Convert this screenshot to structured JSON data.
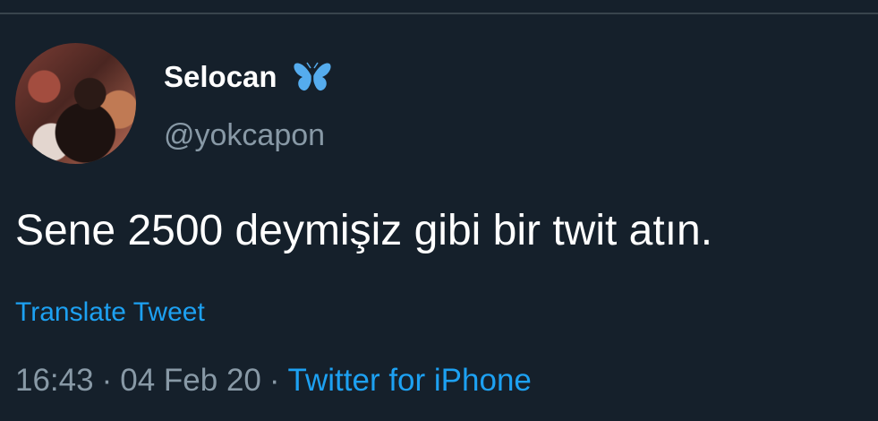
{
  "tweet": {
    "author": {
      "display_name": "Selocan",
      "handle": "@yokcapon",
      "badge_emoji": "butterfly-icon",
      "avatar_icon": "profile-photo"
    },
    "text": "Sene 2500 deymişiz gibi bir twit atın.",
    "translate_label": "Translate Tweet",
    "time": "16:43",
    "separator": "·",
    "date": "04 Feb 20",
    "source": "Twitter for iPhone"
  },
  "colors": {
    "background": "#15202b",
    "primary_text": "#ffffff",
    "secondary_text": "#8899a6",
    "link": "#1da1f2",
    "divider": "#38444d",
    "butterfly": "#55acee"
  }
}
